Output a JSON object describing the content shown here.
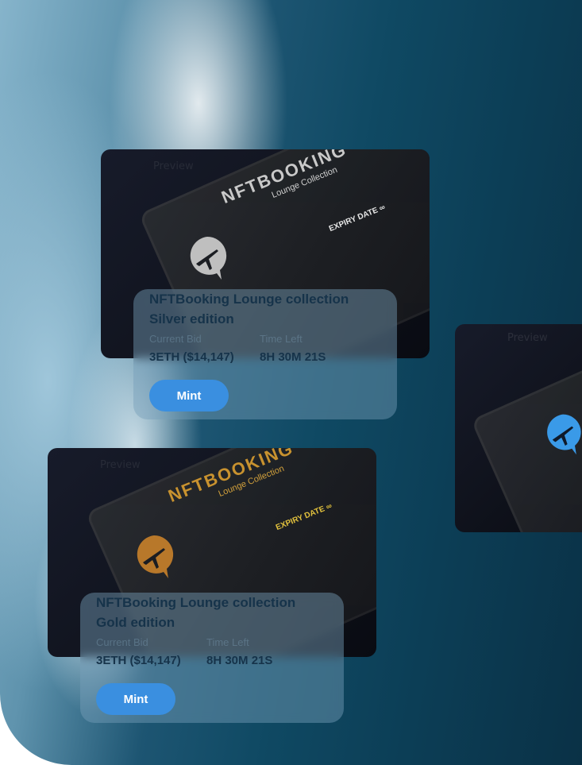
{
  "cards": [
    {
      "card_brand": "NFTBOOKING",
      "card_subtitle": "Lounge Collection",
      "card_expiry": "EXPIRY DATE",
      "preview_label": "Preview",
      "title_line1": "NFTBooking Lounge collection",
      "title_line2": "Silver edition",
      "bid_label": "Current Bid",
      "bid_value": "3ETH ($14,147)",
      "time_label": "Time Left",
      "time_value": "8H 30M 21S",
      "mint_label": "Mint",
      "accent_color": "#c9c9c9",
      "logo_color": "#bfbfbf"
    },
    {
      "card_brand": "NFTBOOKING",
      "card_subtitle": "Lounge Collection",
      "card_expiry": "EXPIRY DATE",
      "preview_label": "Preview",
      "title_line1": "NFTBooking Lounge collection",
      "title_line2": "Gold edition",
      "bid_label": "Current Bid",
      "bid_value": "3ETH ($14,147)",
      "time_label": "Time Left",
      "time_value": "8H 30M 21S",
      "mint_label": "Mint",
      "accent_color": "#c8922f",
      "logo_color": "#b8782a"
    }
  ],
  "partial_card": {
    "preview_label": "Preview",
    "logo_color": "#3a9ae8"
  }
}
